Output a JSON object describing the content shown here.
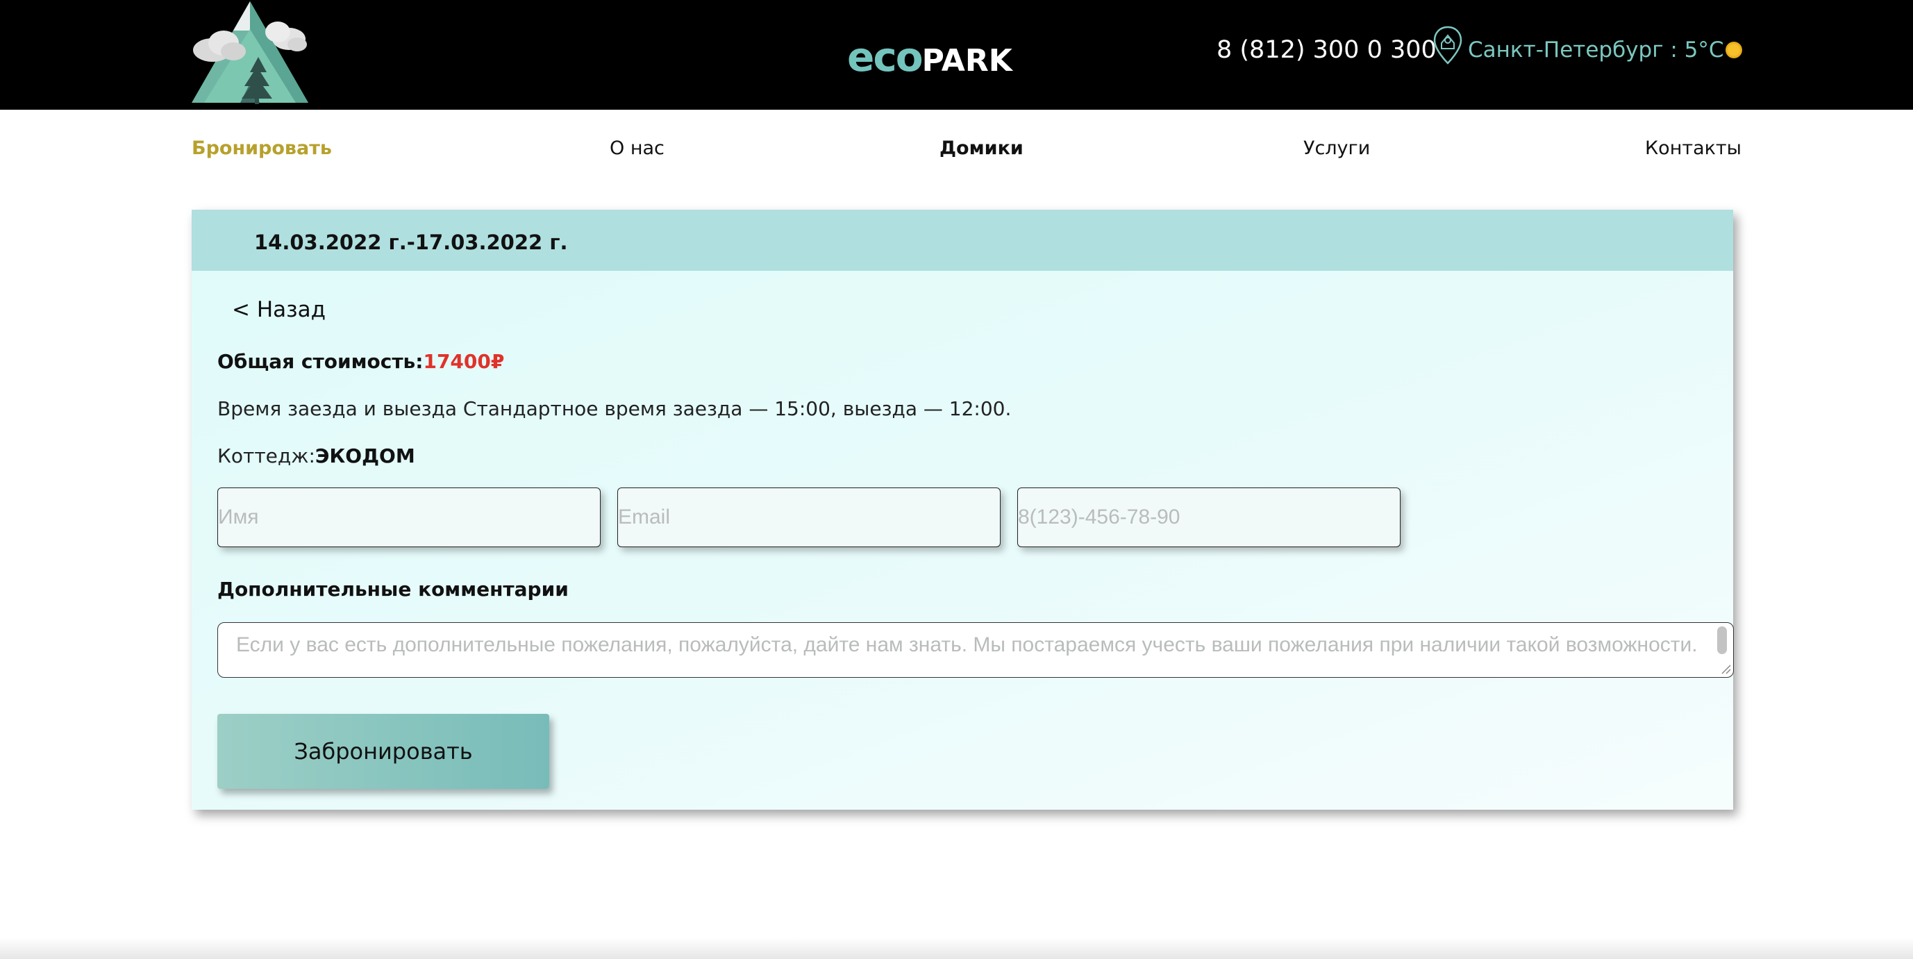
{
  "header": {
    "brand_part1": "eco",
    "brand_part2": "PARK",
    "phone": "8 (812) 300 0 300",
    "city_weather": "Санкт-Петербург : 5°C",
    "icons": {
      "logo": "mountain-tree-logo",
      "location": "location-pin-icon",
      "weather": "sun-icon"
    }
  },
  "nav": {
    "book": "Бронировать",
    "about": "О нас",
    "houses": "Домики",
    "services": "Услуги",
    "contacts": "Контакты"
  },
  "booking": {
    "dates": "14.03.2022 г.-17.03.2022 г.",
    "back": "< Назад",
    "total_label": "Общая стоимость:",
    "total_value": "17400₽",
    "times": "Время заезда и выезда Стандартное время заезда — 15:00, выезда — 12:00.",
    "cottage_label": "Коттедж:",
    "cottage_value": "ЭКОДОМ",
    "name_placeholder": "Имя",
    "email_placeholder": "Email",
    "phone_placeholder": "8(123)-456-78-90",
    "comments_label": "Дополнительные комментарии",
    "comments_placeholder": "Если у вас есть дополнительные пожелания, пожалуйста, дайте нам знать. Мы постараемся учесть ваши пожелания при наличии такой возможности.",
    "submit": "Забронировать"
  },
  "colors": {
    "header_bg": "#000000",
    "brand_accent": "#73c4bd",
    "nav_active": "#b7a12c",
    "price": "#e0322a",
    "card_header": "#b0dfdf",
    "card_bg": "#dffbfa"
  }
}
